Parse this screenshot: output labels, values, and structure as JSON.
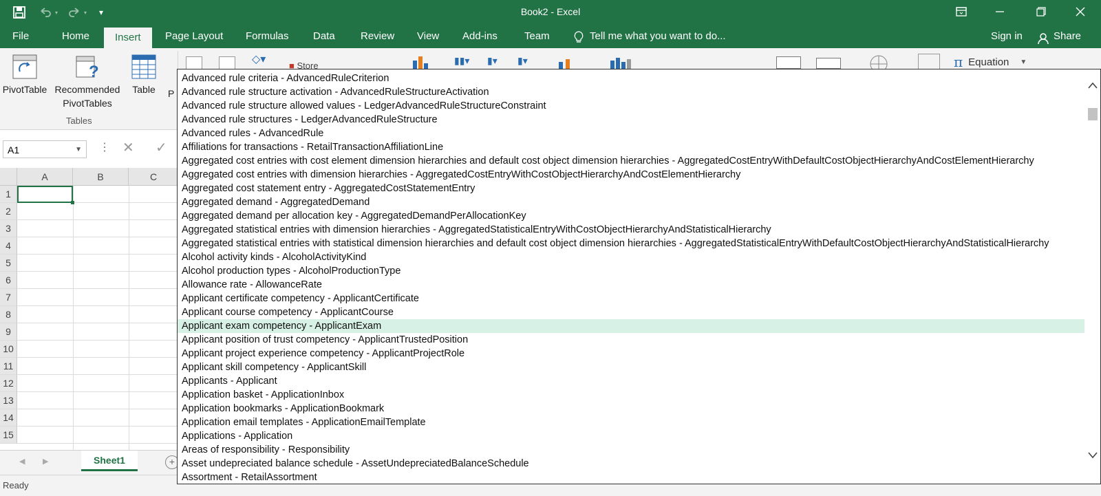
{
  "window": {
    "title": "Book2 - Excel"
  },
  "icons": {
    "save": "save-icon",
    "undo": "undo-icon",
    "redo": "redo-icon",
    "customize": "customize-qat-icon",
    "ribbon_display": "ribbon-display-options-icon",
    "minimize": "minimize-icon",
    "restore": "restore-icon",
    "close": "close-icon",
    "share": "person-icon",
    "lightbulb": "lightbulb-icon"
  },
  "tabs": [
    {
      "label": "File"
    },
    {
      "label": "Home"
    },
    {
      "label": "Insert"
    },
    {
      "label": "Page Layout"
    },
    {
      "label": "Formulas"
    },
    {
      "label": "Data"
    },
    {
      "label": "Review"
    },
    {
      "label": "View"
    },
    {
      "label": "Add-ins"
    },
    {
      "label": "Team"
    }
  ],
  "tellme": "Tell me what you want to do...",
  "signin": "Sign in",
  "share": "Share",
  "ribbon": {
    "pivottable": "PivotTable",
    "recommended_line1": "Recommended",
    "recommended_line2": "PivotTables",
    "table": "Table",
    "partial_p": "P",
    "group_tables": "Tables",
    "equation": "Equation",
    "store_partial": "Store"
  },
  "namebox": "A1",
  "columns": [
    "A",
    "B",
    "C"
  ],
  "rows": [
    "1",
    "2",
    "3",
    "4",
    "5",
    "6",
    "7",
    "8",
    "9",
    "10",
    "11",
    "12",
    "13",
    "14",
    "15"
  ],
  "sheet_tab": "Sheet1",
  "status": "Ready",
  "dropdown": {
    "selected_index": 18,
    "items": [
      "Advanced rule criteria - AdvancedRuleCriterion",
      "Advanced rule structure activation - AdvancedRuleStructureActivation",
      "Advanced rule structure allowed values - LedgerAdvancedRuleStructureConstraint",
      "Advanced rule structures - LedgerAdvancedRuleStructure",
      "Advanced rules - AdvancedRule",
      "Affiliations for transactions - RetailTransactionAffiliationLine",
      "Aggregated cost entries with cost element dimension hierarchies and default cost object dimension hierarchies - AggregatedCostEntryWithDefaultCostObjectHierarchyAndCostElementHierarchy",
      "Aggregated cost entries with dimension hierarchies - AggregatedCostEntryWithCostObjectHierarchyAndCostElementHierarchy",
      "Aggregated cost statement entry - AggregatedCostStatementEntry",
      "Aggregated demand - AggregatedDemand",
      "Aggregated demand per allocation key - AggregatedDemandPerAllocationKey",
      "Aggregated statistical entries with dimension hierarchies - AggregatedStatisticalEntryWithCostObjectHierarchyAndStatisticalHierarchy",
      "Aggregated statistical entries with statistical dimension hierarchies and default cost object dimension hierarchies - AggregatedStatisticalEntryWithDefaultCostObjectHierarchyAndStatisticalHierarchy",
      "Alcohol activity kinds - AlcoholActivityKind",
      "Alcohol production types - AlcoholProductionType",
      "Allowance rate - AllowanceRate",
      "Applicant certificate competency - ApplicantCertificate",
      "Applicant course competency - ApplicantCourse",
      "Applicant exam competency - ApplicantExam",
      "Applicant position of trust competency - ApplicantTrustedPosition",
      "Applicant project experience competency - ApplicantProjectRole",
      "Applicant skill competency - ApplicantSkill",
      "Applicants - Applicant",
      "Application basket - ApplicationInbox",
      "Application bookmarks - ApplicationBookmark",
      "Application email templates - ApplicationEmailTemplate",
      "Applications - Application",
      "Areas of responsibility - Responsibility",
      "Asset undepreciated balance schedule - AssetUndepreciatedBalanceSchedule",
      "Assortment - RetailAssortment"
    ]
  }
}
